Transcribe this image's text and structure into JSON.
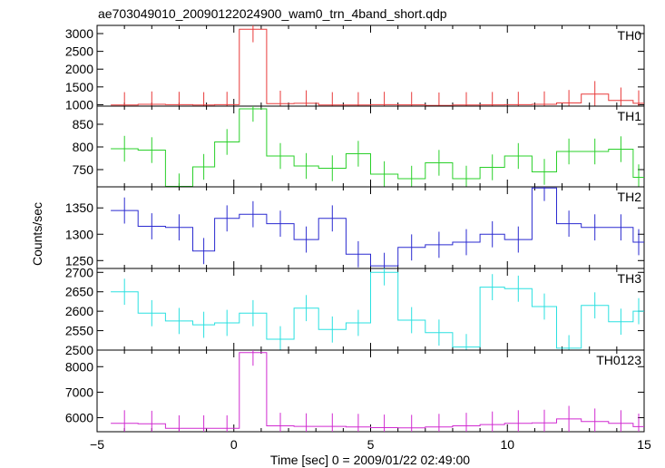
{
  "chart_data": {
    "type": "line",
    "title": "ae703049010_20090122024900_wam0_trn_4band_short.qdp",
    "xlabel": "Time [sec] 0 = 2009/01/22 02:49:00",
    "ylabel": "Counts/sec",
    "xlim": [
      -5,
      15
    ],
    "xticks": [
      -5,
      0,
      5,
      10,
      15
    ],
    "xtick_labels": [
      "−5",
      "0",
      "5",
      "10",
      "15"
    ],
    "bin_edges": [
      -4.5,
      -3.5,
      -2.5,
      -1.5,
      -0.7,
      0.2,
      1.2,
      2.2,
      3.1,
      4.1,
      5.0,
      6.0,
      7.0,
      8.0,
      9.0,
      9.9,
      10.9,
      11.8,
      12.7,
      13.7,
      14.6,
      15.0
    ],
    "panels": [
      {
        "name": "TH0",
        "color": "#e83a3a",
        "ylim": [
          960,
          3230
        ],
        "yticks": [
          1000,
          1500,
          2000,
          2500,
          3000
        ],
        "values": [
          990,
          1010,
          1000,
          990,
          1000,
          3120,
          1030,
          1040,
          990,
          990,
          1000,
          995,
          980,
          990,
          995,
          1000,
          1010,
          1050,
          1300,
          1120,
          1040
        ]
      },
      {
        "name": "TH1",
        "color": "#2ad02a",
        "ylim": [
          712,
          890
        ],
        "yticks": [
          750,
          800,
          850
        ],
        "values": [
          796,
          793,
          713,
          756,
          811,
          884,
          780,
          758,
          753,
          785,
          740,
          730,
          765,
          730,
          755,
          780,
          745,
          790,
          790,
          795,
          733
        ]
      },
      {
        "name": "TH2",
        "color": "#2a2ad0",
        "ylim": [
          1235,
          1390
        ],
        "yticks": [
          1250,
          1300,
          1350
        ],
        "values": [
          1345,
          1315,
          1313,
          1268,
          1330,
          1338,
          1320,
          1290,
          1330,
          1262,
          1240,
          1275,
          1280,
          1285,
          1300,
          1290,
          1388,
          1320,
          1313,
          1313,
          1285
        ]
      },
      {
        "name": "TH3",
        "color": "#2ae0e0",
        "ylim": [
          2500,
          2710
        ],
        "yticks": [
          2500,
          2550,
          2600,
          2650,
          2700
        ],
        "values": [
          2650,
          2595,
          2575,
          2565,
          2570,
          2595,
          2528,
          2608,
          2553,
          2570,
          2700,
          2577,
          2545,
          2508,
          2662,
          2658,
          2612,
          2505,
          2615,
          2573,
          2600
        ]
      },
      {
        "name": "TH0123",
        "color": "#d02ad0",
        "ylim": [
          5450,
          8650
        ],
        "yticks": [
          6000,
          7000,
          8000
        ],
        "values": [
          5780,
          5760,
          5580,
          5580,
          5580,
          8550,
          5680,
          5660,
          5660,
          5640,
          5610,
          5600,
          5640,
          5680,
          5730,
          5780,
          5800,
          5950,
          5850,
          5780,
          5650
        ]
      }
    ]
  }
}
